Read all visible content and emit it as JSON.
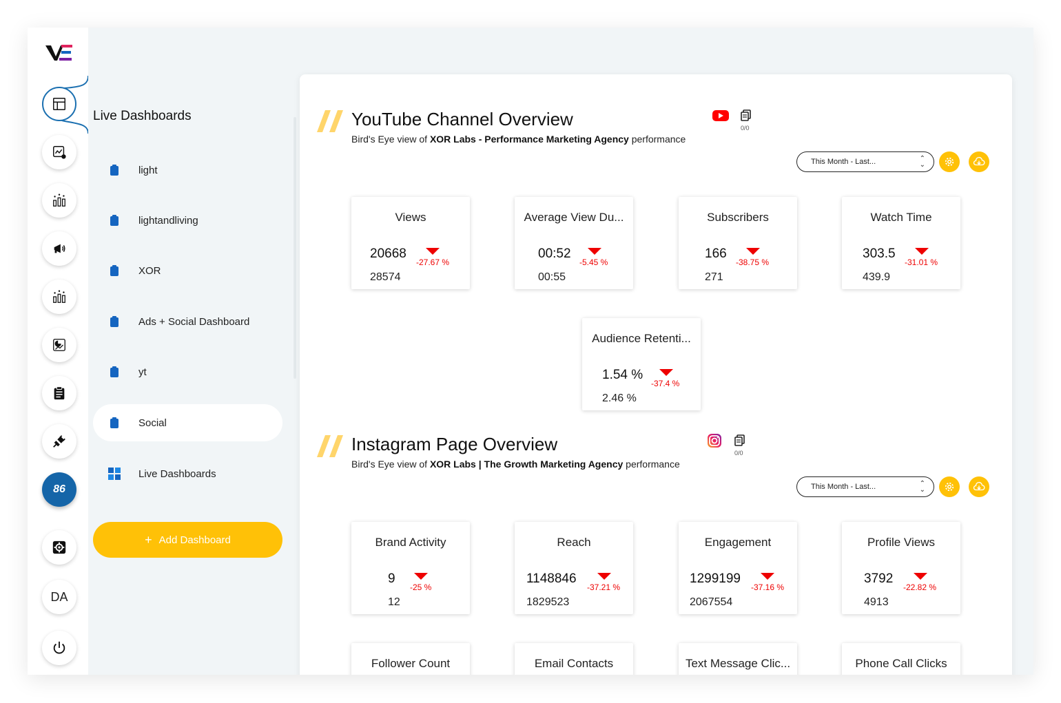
{
  "rail": {
    "logo_text": "VE",
    "badge_count": "86",
    "user_initials": "DA"
  },
  "sidebar": {
    "title": "Live Dashboards",
    "items": [
      {
        "label": "light",
        "selected": false
      },
      {
        "label": "lightandliving",
        "selected": false
      },
      {
        "label": "XOR",
        "selected": false
      },
      {
        "label": "Ads + Social Dashboard",
        "selected": false
      },
      {
        "label": "yt",
        "selected": false
      },
      {
        "label": "Social",
        "selected": true
      },
      {
        "label": "Live Dashboards",
        "selected": false
      }
    ],
    "add_button_plus": "+",
    "add_button_label": "Add Dashboard"
  },
  "youtube": {
    "title": "YouTube Channel Overview",
    "subtitle_prefix": "Bird's Eye view of ",
    "subtitle_bold": "XOR Labs - Performance Marketing Agency",
    "subtitle_suffix": " performance",
    "copy_count": "0/0",
    "date_range": "This Month - Last...",
    "metrics": [
      {
        "title": "Views",
        "value": "20668",
        "change": "-27.67 %",
        "previous": "28574"
      },
      {
        "title": "Average View Du...",
        "value": "00:52",
        "change": "-5.45 %",
        "previous": "00:55"
      },
      {
        "title": "Subscribers",
        "value": "166",
        "change": "-38.75 %",
        "previous": "271"
      },
      {
        "title": "Watch Time",
        "value": "303.5",
        "change": "-31.01 %",
        "previous": "439.9"
      },
      {
        "title": "Audience Retenti...",
        "value": "1.54 %",
        "change": "-37.4 %",
        "previous": "2.46 %"
      }
    ]
  },
  "instagram": {
    "title": "Instagram Page Overview",
    "subtitle_prefix": "Bird's Eye view of ",
    "subtitle_bold": "XOR Labs | The Growth Marketing Agency",
    "subtitle_suffix": " performance",
    "copy_count": "0/0",
    "date_range": "This Month - Last...",
    "metrics": [
      {
        "title": "Brand Activity",
        "value": "9",
        "change": "-25 %",
        "previous": "12"
      },
      {
        "title": "Reach",
        "value": "1148846",
        "change": "-37.21 %",
        "previous": "1829523"
      },
      {
        "title": "Engagement",
        "value": "1299199",
        "change": "-37.16 %",
        "previous": "2067554"
      },
      {
        "title": "Profile Views",
        "value": "3792",
        "change": "-22.82 %",
        "previous": "4913"
      },
      {
        "title": "Follower Count"
      },
      {
        "title": "Email Contacts"
      },
      {
        "title": "Text Message Clic..."
      },
      {
        "title": "Phone Call Clicks"
      }
    ]
  },
  "colors": {
    "accent_gold": "#ffc107",
    "decrease_red": "#e00000",
    "youtube_red": "#ff0000",
    "rail_active": "#1a6fb0"
  }
}
